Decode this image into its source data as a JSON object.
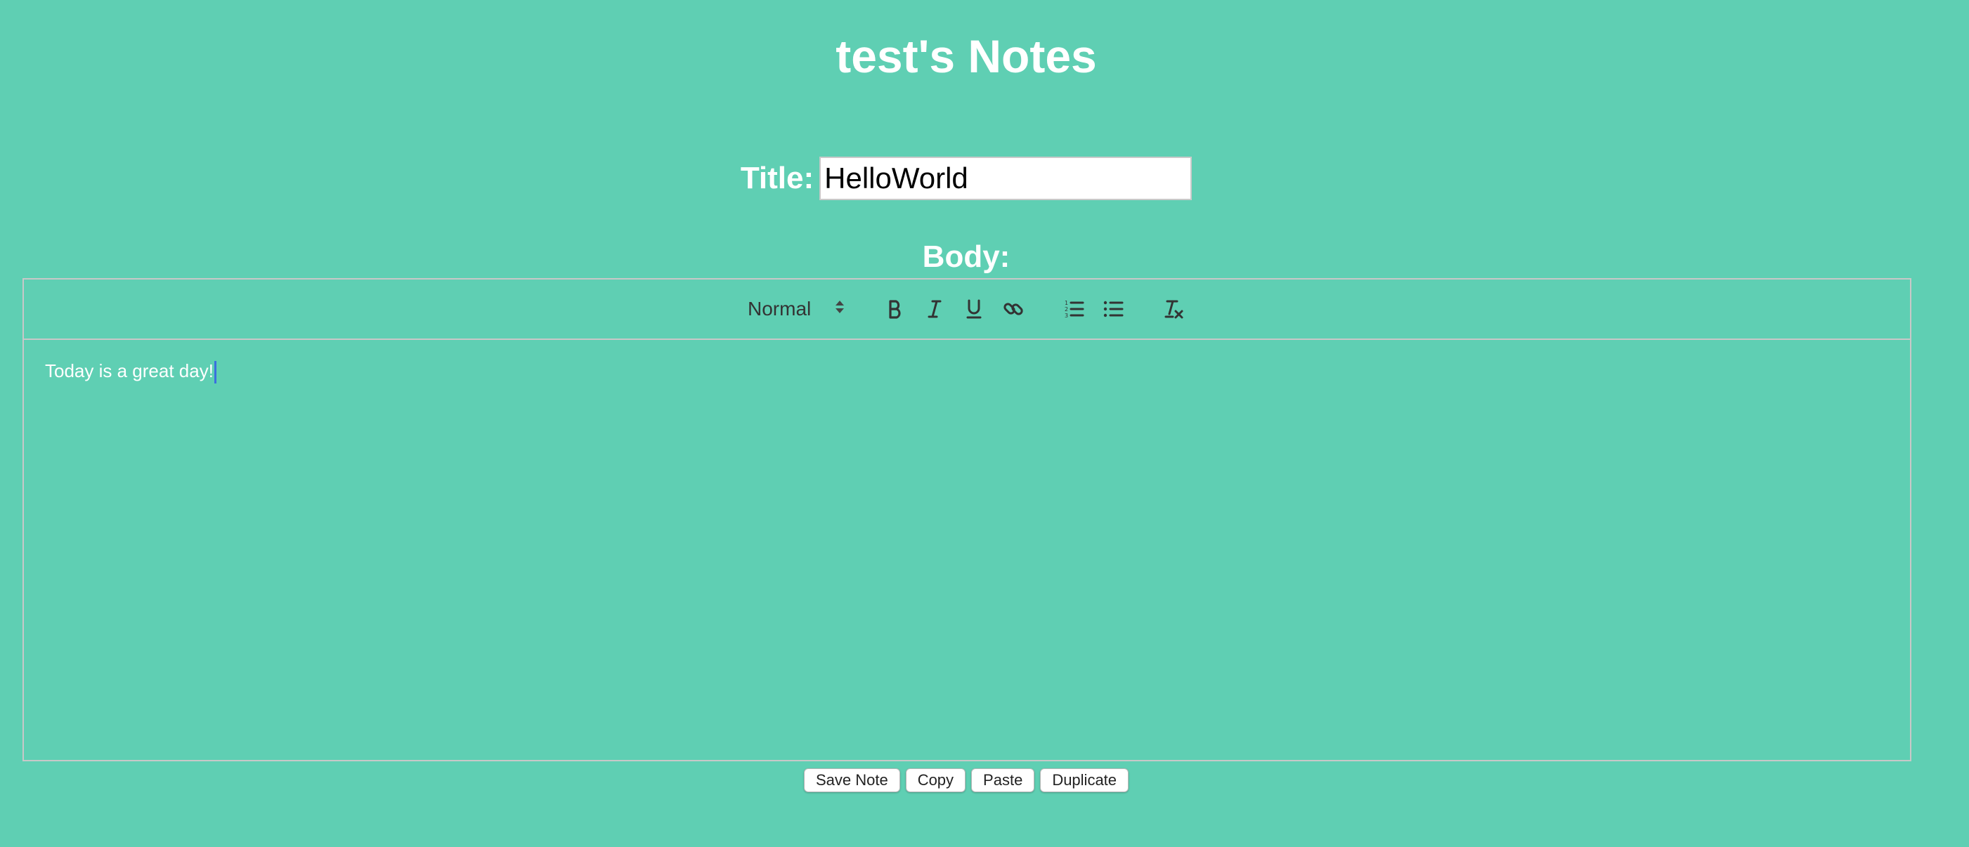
{
  "header": {
    "title": "test's Notes"
  },
  "form": {
    "title_label": "Title:",
    "title_value": "HelloWorld",
    "body_label": "Body:"
  },
  "editor": {
    "header_format": "Normal",
    "toolbar_icons": [
      "bold-icon",
      "italic-icon",
      "underline-icon",
      "link-icon",
      "ordered-list-icon",
      "bullet-list-icon",
      "clear-format-icon"
    ],
    "content": "Today is a great day!"
  },
  "actions": {
    "save": "Save Note",
    "copy": "Copy",
    "paste": "Paste",
    "duplicate": "Duplicate"
  },
  "colors": {
    "background": "#5fcfb3",
    "text": "#ffffff",
    "toolbar_icon": "#333333",
    "caret": "#3b6fe0"
  }
}
